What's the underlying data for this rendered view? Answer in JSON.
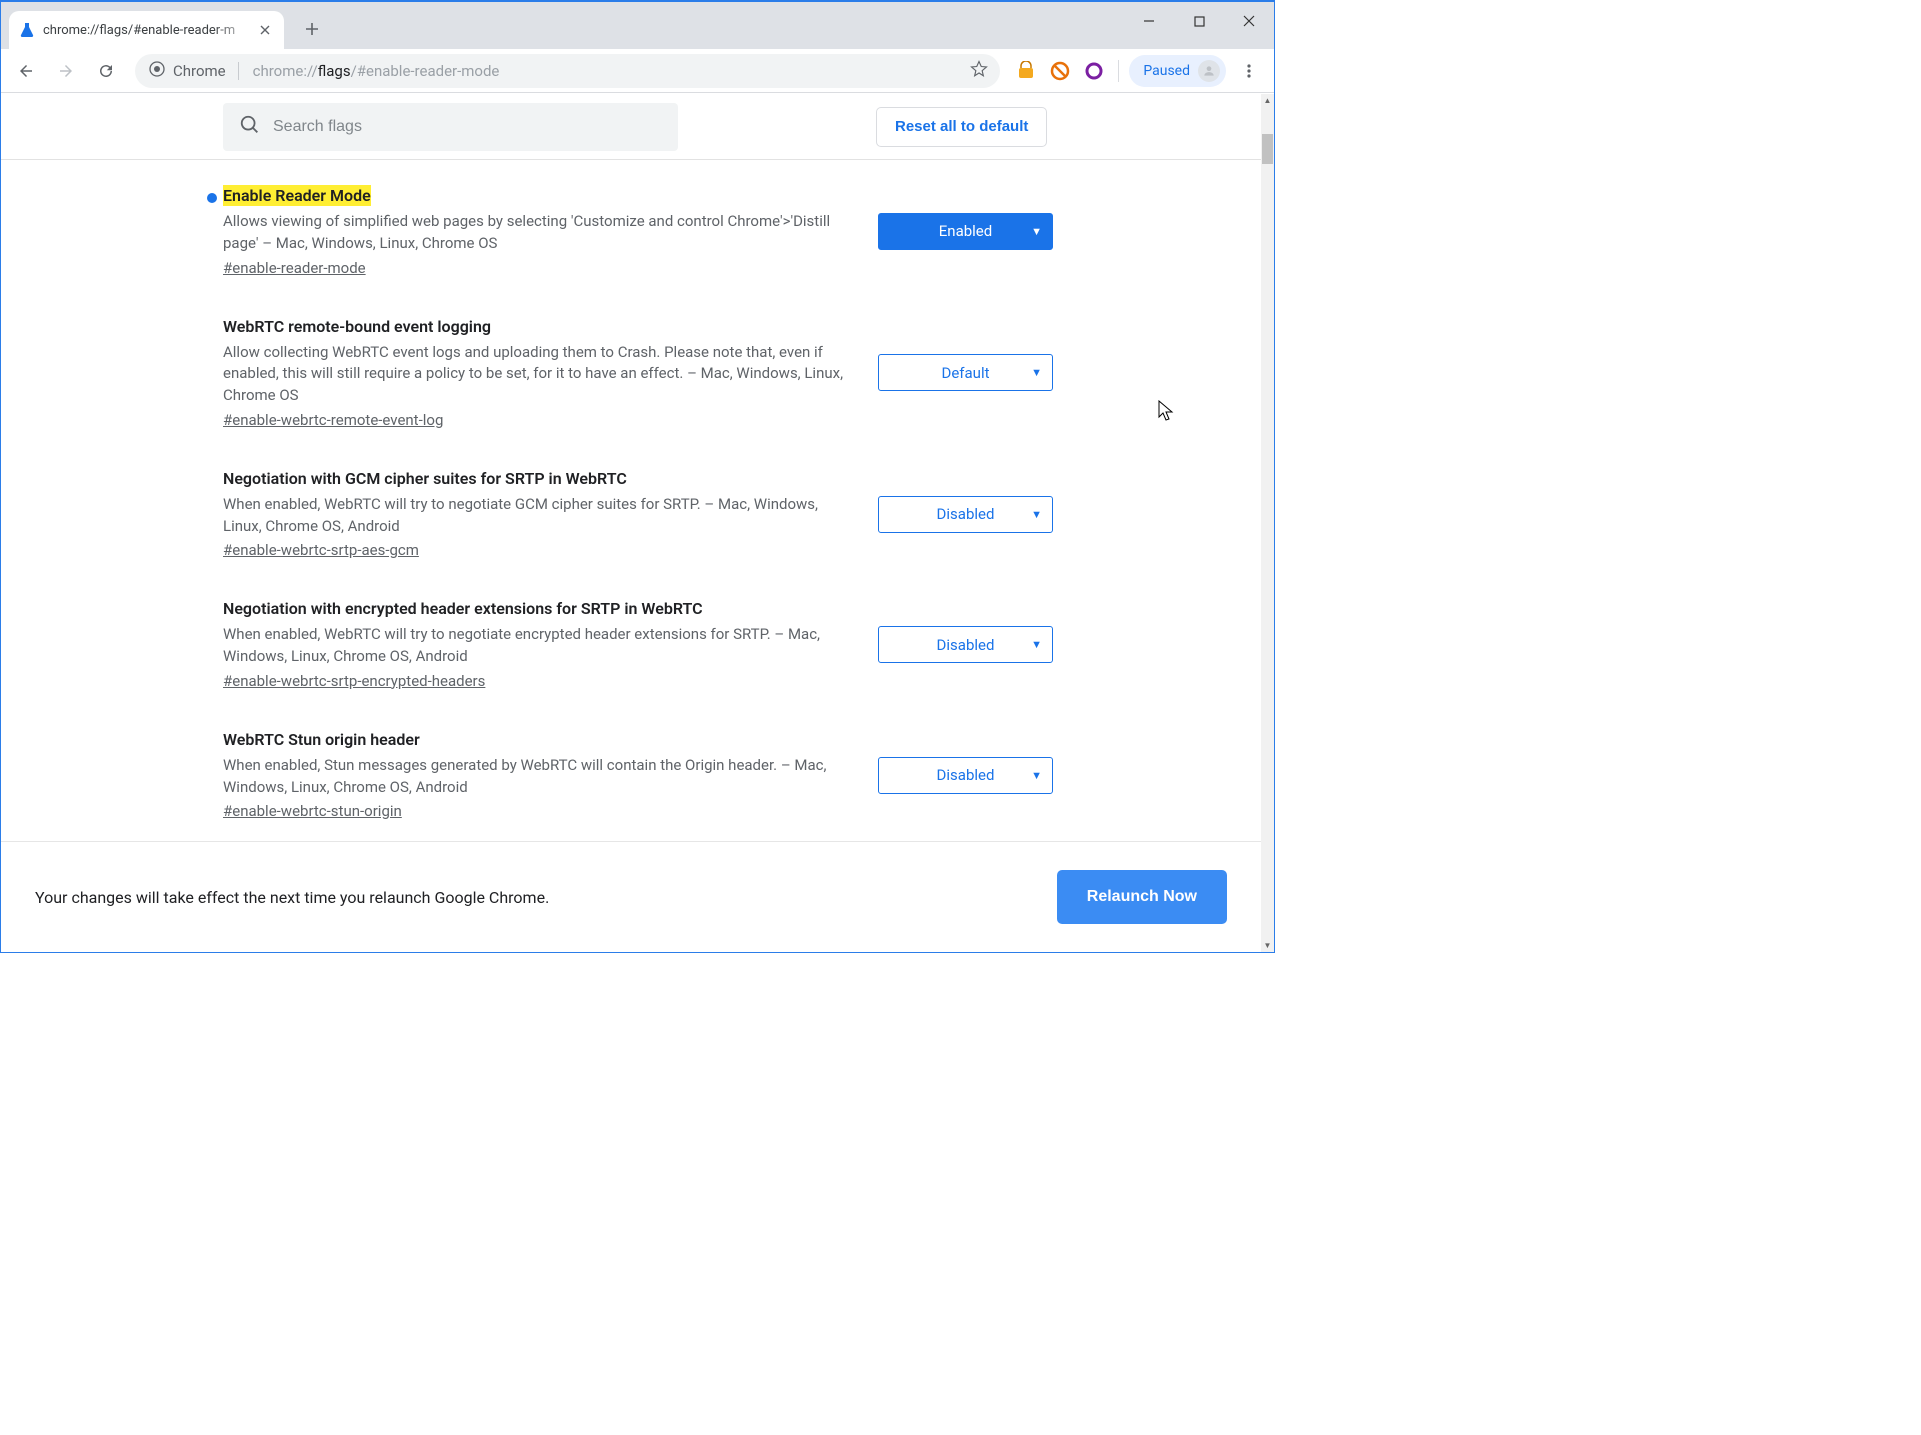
{
  "window": {
    "tab_title": "chrome://flags/#enable-reader-m"
  },
  "toolbar": {
    "chrome_label": "Chrome",
    "url_prefix": "chrome://",
    "url_strong": "flags",
    "url_suffix": "/#enable-reader-mode",
    "profile_status": "Paused"
  },
  "header": {
    "search_placeholder": "Search flags",
    "reset_label": "Reset all to default"
  },
  "flags": [
    {
      "modified": true,
      "highlighted": true,
      "title": "Enable Reader Mode",
      "desc": "Allows viewing of simplified web pages by selecting 'Customize and control Chrome'>'Distill page' – Mac, Windows, Linux, Chrome OS",
      "anchor": "#enable-reader-mode",
      "value": "Enabled",
      "style": "enabled"
    },
    {
      "modified": false,
      "highlighted": false,
      "title": "WebRTC remote-bound event logging",
      "desc": "Allow collecting WebRTC event logs and uploading them to Crash. Please note that, even if enabled, this will still require a policy to be set, for it to have an effect. – Mac, Windows, Linux, Chrome OS",
      "anchor": "#enable-webrtc-remote-event-log",
      "value": "Default",
      "style": "default"
    },
    {
      "modified": false,
      "highlighted": false,
      "title": "Negotiation with GCM cipher suites for SRTP in WebRTC",
      "desc": "When enabled, WebRTC will try to negotiate GCM cipher suites for SRTP. – Mac, Windows, Linux, Chrome OS, Android",
      "anchor": "#enable-webrtc-srtp-aes-gcm",
      "value": "Disabled",
      "style": "default"
    },
    {
      "modified": false,
      "highlighted": false,
      "title": "Negotiation with encrypted header extensions for SRTP in WebRTC",
      "desc": "When enabled, WebRTC will try to negotiate encrypted header extensions for SRTP. – Mac, Windows, Linux, Chrome OS, Android",
      "anchor": "#enable-webrtc-srtp-encrypted-headers",
      "value": "Disabled",
      "style": "default"
    },
    {
      "modified": false,
      "highlighted": false,
      "title": "WebRTC Stun origin header",
      "desc": "When enabled, Stun messages generated by WebRTC will contain the Origin header. – Mac, Windows, Linux, Chrome OS, Android",
      "anchor": "#enable-webrtc-stun-origin",
      "value": "Disabled",
      "style": "default"
    }
  ],
  "relaunch": {
    "message": "Your changes will take effect the next time you relaunch Google Chrome.",
    "button": "Relaunch Now"
  }
}
